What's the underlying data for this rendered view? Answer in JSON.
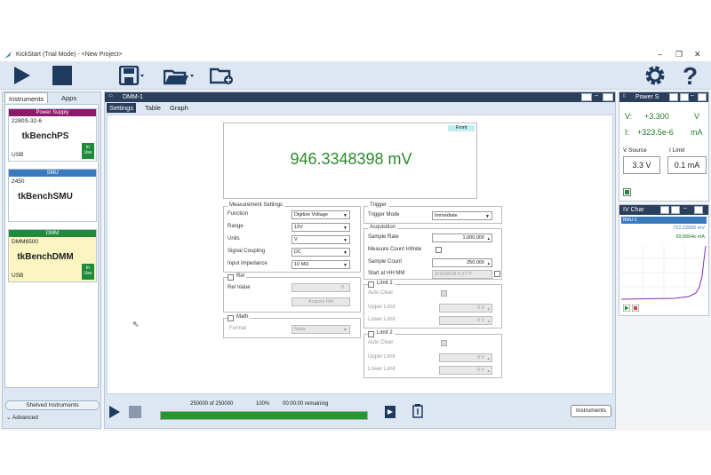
{
  "window": {
    "title": "KickStart (Trial Mode) - <New Project>",
    "controls": [
      "–",
      "❐",
      "✕"
    ]
  },
  "toolbar": {
    "icons": [
      "play-icon",
      "stop-icon",
      "save-icon",
      "open-folder-icon",
      "new-folder-icon",
      "gear-icon",
      "help-icon"
    ]
  },
  "left": {
    "tabs": [
      "Instruments",
      "Apps"
    ],
    "cards": [
      {
        "header": "Power Supply",
        "header_color": "#8b1a6b",
        "model": "2280S-32-6",
        "name": "tkBenchPS",
        "iface": "USB",
        "inuse": "In Use",
        "bg": "#ffffff"
      },
      {
        "header": "SMU",
        "header_color": "#3a7bbf",
        "model": "2450",
        "name": "tkBenchSMU",
        "iface": "",
        "inuse": "",
        "bg": "#ffffff"
      },
      {
        "header": "DMM",
        "header_color": "#1e8a3a",
        "model": "DMM6500",
        "name": "tkBenchDMM",
        "iface": "USB",
        "inuse": "In Use",
        "bg": "#fbf5c2"
      }
    ],
    "shelved": "Shelved Instruments",
    "advanced": "Advanced"
  },
  "center": {
    "title": "DMM-1",
    "tabs": [
      "Settings",
      "Table",
      "Graph"
    ],
    "readout": {
      "mode": "Front",
      "value": "946.3348398 mV"
    },
    "measurement": {
      "title": "Measurement Settings",
      "rows": [
        {
          "label": "Function",
          "value": "Digitize Voltage"
        },
        {
          "label": "Range",
          "value": "10V"
        },
        {
          "label": "Units",
          "value": "V"
        },
        {
          "label": "Signal Coupling",
          "value": "DC"
        },
        {
          "label": "Input Impedance",
          "value": "10 MΩ"
        }
      ]
    },
    "rel": {
      "title": "Rel",
      "value_label": "Rel Value",
      "value": "0",
      "button": "Acquire Rel"
    },
    "math": {
      "title": "Math",
      "format_label": "Format",
      "format_value": "None"
    },
    "trigger": {
      "title": "Trigger",
      "mode_label": "Trigger Mode",
      "mode_value": "Immediate"
    },
    "acquisition": {
      "title": "Acquisition",
      "sample_rate_label": "Sample Rate",
      "sample_rate": "1,000,000",
      "measure_infinite_label": "Measure Count Infinite",
      "sample_count_label": "Sample Count",
      "sample_count": "250,000",
      "start_label": "Start at HH:MM",
      "start_value": "3/16/2018 5:27 P"
    },
    "limit1": {
      "title": "Limit 1",
      "auto_clear": "Auto Clear",
      "upper": "Upper Limit",
      "lower": "Lower Limit",
      "upper_val": "0 V",
      "lower_val": "0 V"
    },
    "limit2": {
      "title": "Limit 2",
      "auto_clear": "Auto Clear",
      "upper": "Upper Limit",
      "lower": "Lower Limit",
      "upper_val": "0 V",
      "lower_val": "0 V"
    },
    "footer": {
      "count": "250000 of 250000",
      "pct": "100%",
      "remaining": "00:00:00 remaining",
      "progress": 1.0,
      "instruments_btn": "Instruments"
    }
  },
  "power": {
    "title": "Power S",
    "v_label": "V:",
    "v_value": "+3.300",
    "v_unit": "V",
    "i_label": "I:",
    "i_value": "+323.5e-6",
    "i_unit": "mA",
    "vsource_label": "V Source",
    "ilimit_label": "I Limit",
    "vsource": "3.3 V",
    "ilimit": "0.1 mA"
  },
  "ivchart": {
    "title": "IV Char",
    "series_label": "BMU-1",
    "val1": "722.22065 mV",
    "val2": "99.8994e mA"
  }
}
